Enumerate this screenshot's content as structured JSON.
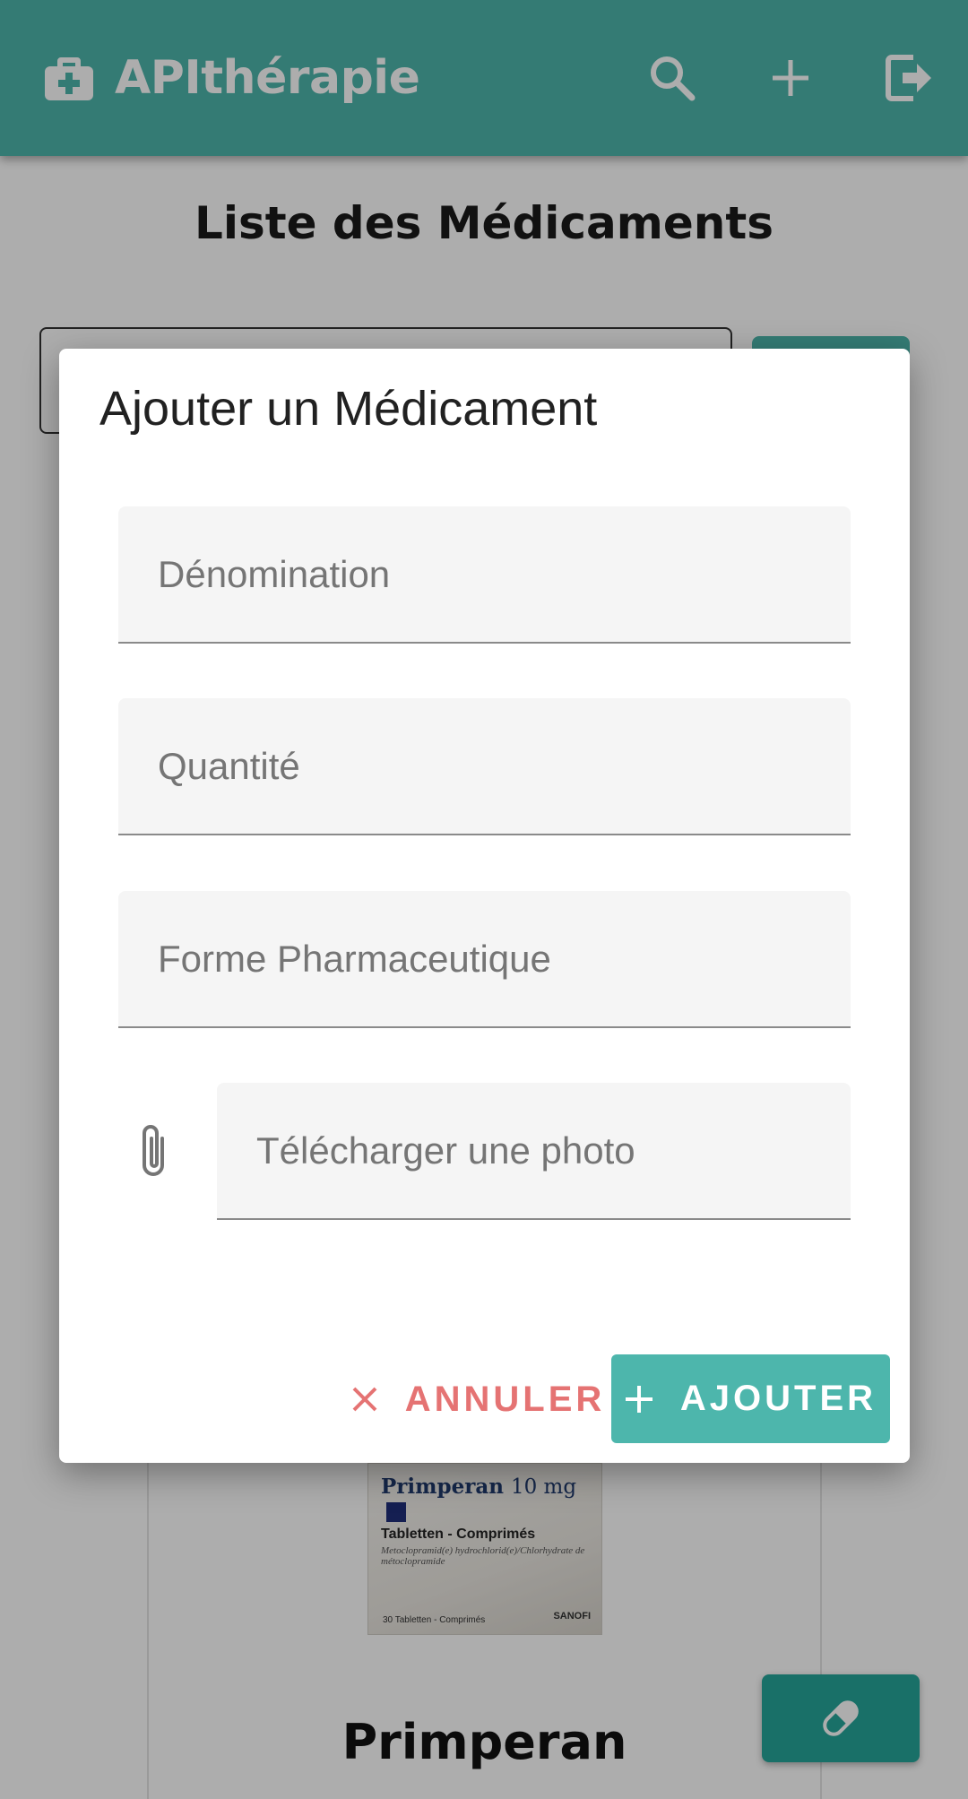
{
  "appbar": {
    "title": "APIthérapie",
    "icons": [
      "medical-bag-icon",
      "search-icon",
      "plus-icon",
      "logout-icon"
    ]
  },
  "page": {
    "title": "Liste des Médicaments"
  },
  "card": {
    "image_text": {
      "name": "Primperan",
      "dose": "10 mg",
      "form": "Tabletten - Comprimés",
      "desc": "Metoclopramid(e) hydrochlorid(e)/Chlorhydrate de métoclopramide",
      "count": "30 Tabletten - Comprimés",
      "brand": "SANOFI"
    },
    "name": "Primperan"
  },
  "dialog": {
    "title": "Ajouter un Médicament",
    "fields": {
      "denomination": {
        "placeholder": "Dénomination",
        "value": ""
      },
      "quantite": {
        "placeholder": "Quantité",
        "value": ""
      },
      "forme": {
        "placeholder": "Forme Pharmaceutique",
        "value": ""
      },
      "photo": {
        "placeholder": "Télécharger une photo",
        "value": ""
      }
    },
    "actions": {
      "cancel_label": "ANNULER",
      "add_label": "AJOUTER"
    }
  },
  "colors": {
    "primary": "#4db6ac",
    "primary_dark": "#26a69a",
    "cancel": "#e57373"
  }
}
